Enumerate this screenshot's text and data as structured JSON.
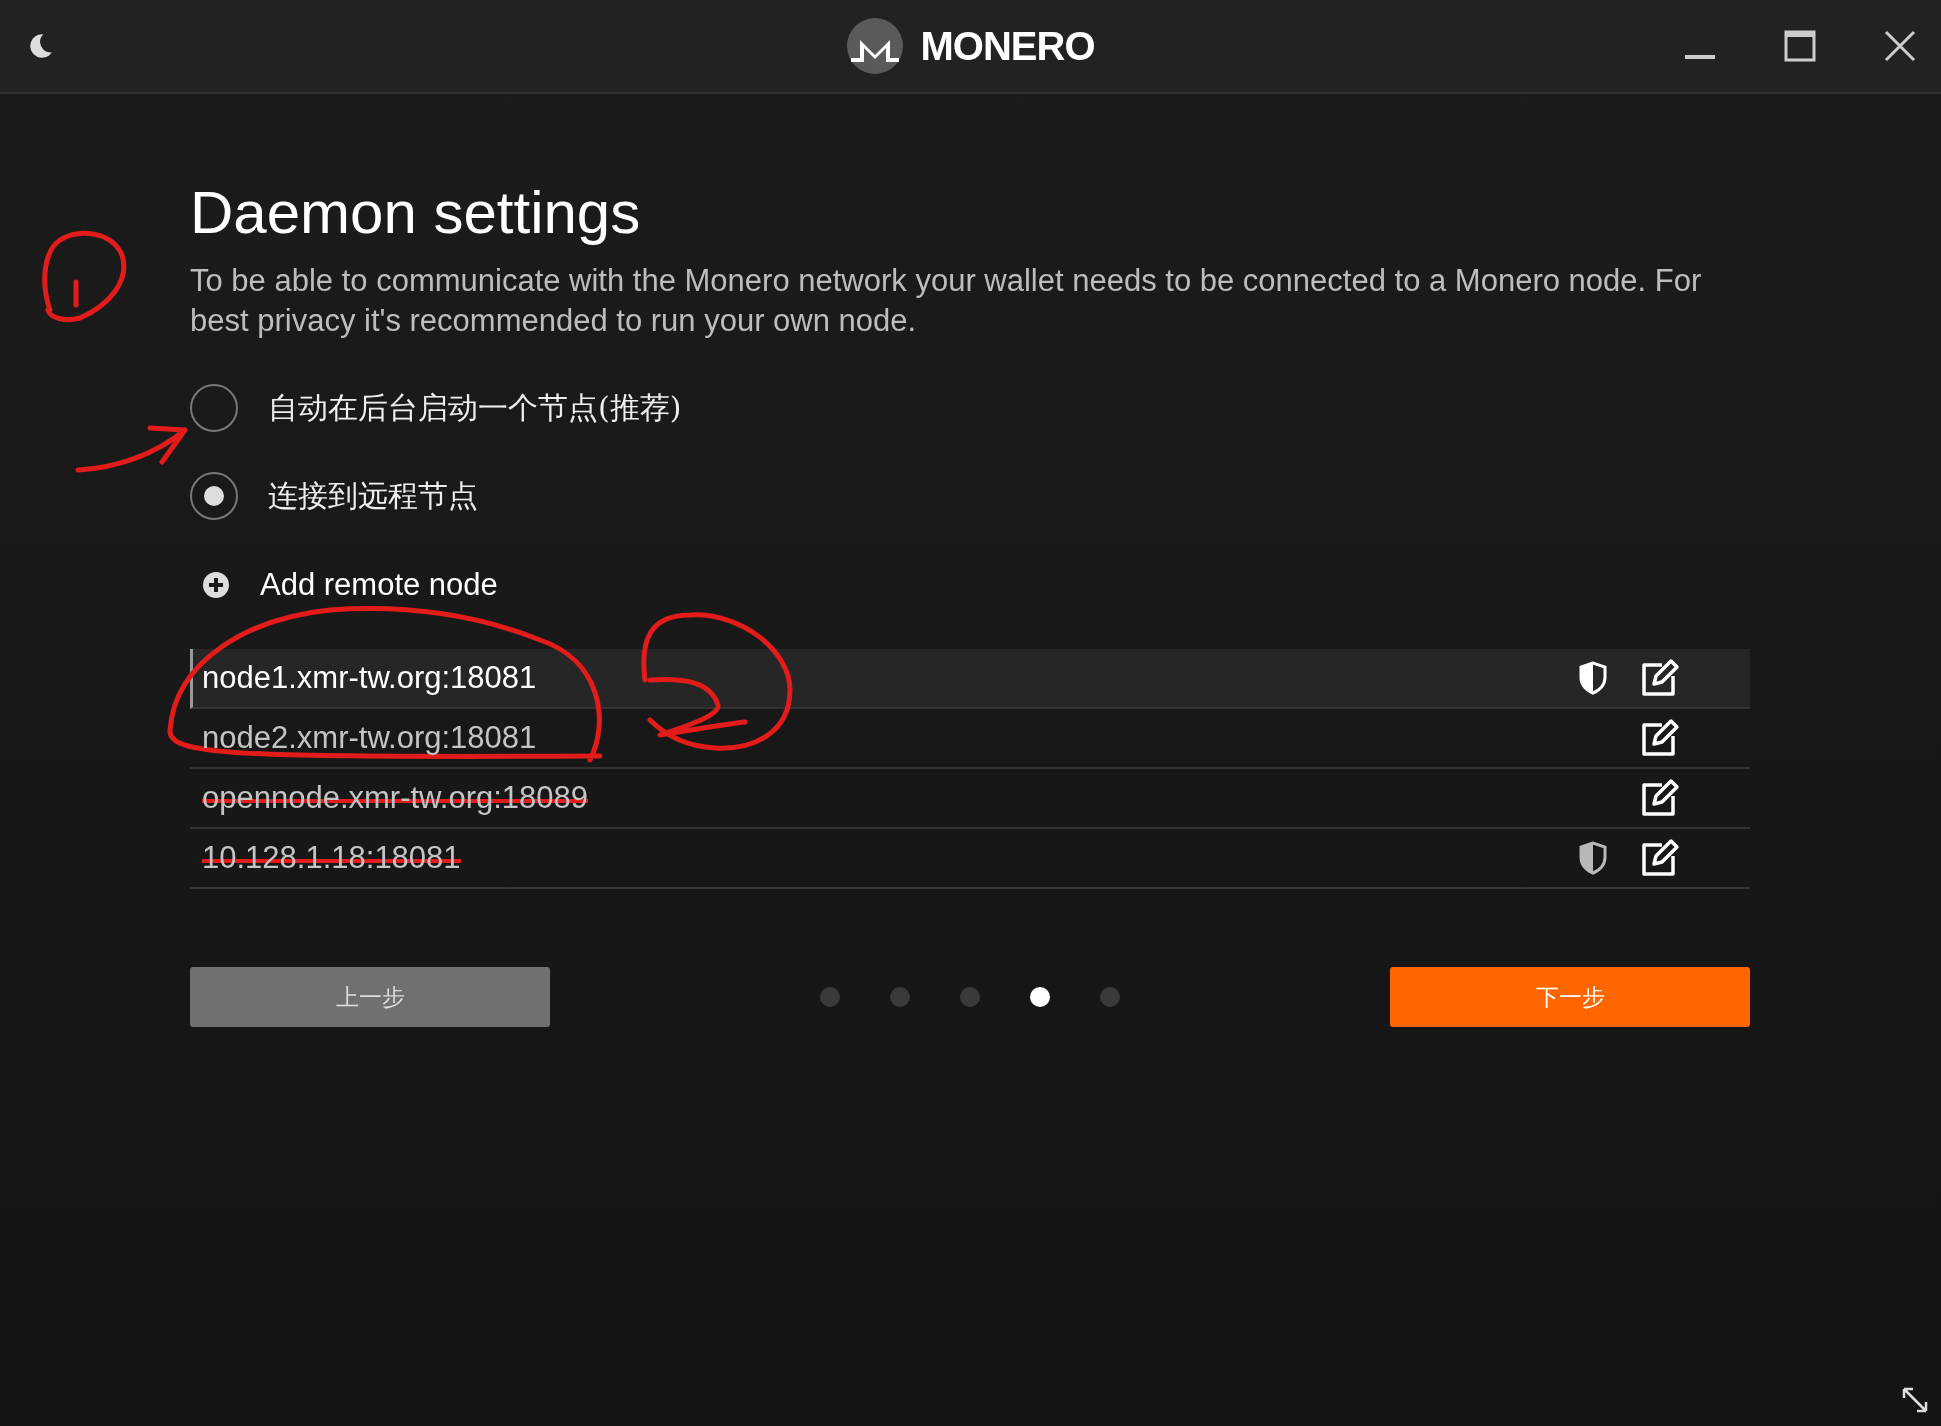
{
  "window": {
    "title": "MONERO"
  },
  "page": {
    "title": "Daemon settings",
    "description": "To be able to communicate with the Monero network your wallet needs to be connected to a Monero node. For best privacy it's recommended to run your own node."
  },
  "options": [
    {
      "label": "自动在后台启动一个节点(推荐)",
      "selected": false
    },
    {
      "label": "连接到远程节点",
      "selected": true
    }
  ],
  "add_node": {
    "label": "Add remote node"
  },
  "nodes": [
    {
      "address": "node1.xmr-tw.org:18081",
      "selected": true,
      "kind": "secure",
      "struck": false
    },
    {
      "address": "node2.xmr-tw.org:18081",
      "selected": false,
      "kind": "plain",
      "struck": false
    },
    {
      "address": "opennode.xmr-tw.org:18089",
      "selected": false,
      "kind": "plain",
      "struck": true
    },
    {
      "address": "10.128.1.18:18081",
      "selected": false,
      "kind": "faded",
      "struck": true
    }
  ],
  "buttons": {
    "back": "上一步",
    "next": "下一步"
  },
  "steps": [
    {
      "selected": false
    },
    {
      "selected": false
    },
    {
      "selected": false
    },
    {
      "selected": true
    },
    {
      "selected": false
    }
  ]
}
